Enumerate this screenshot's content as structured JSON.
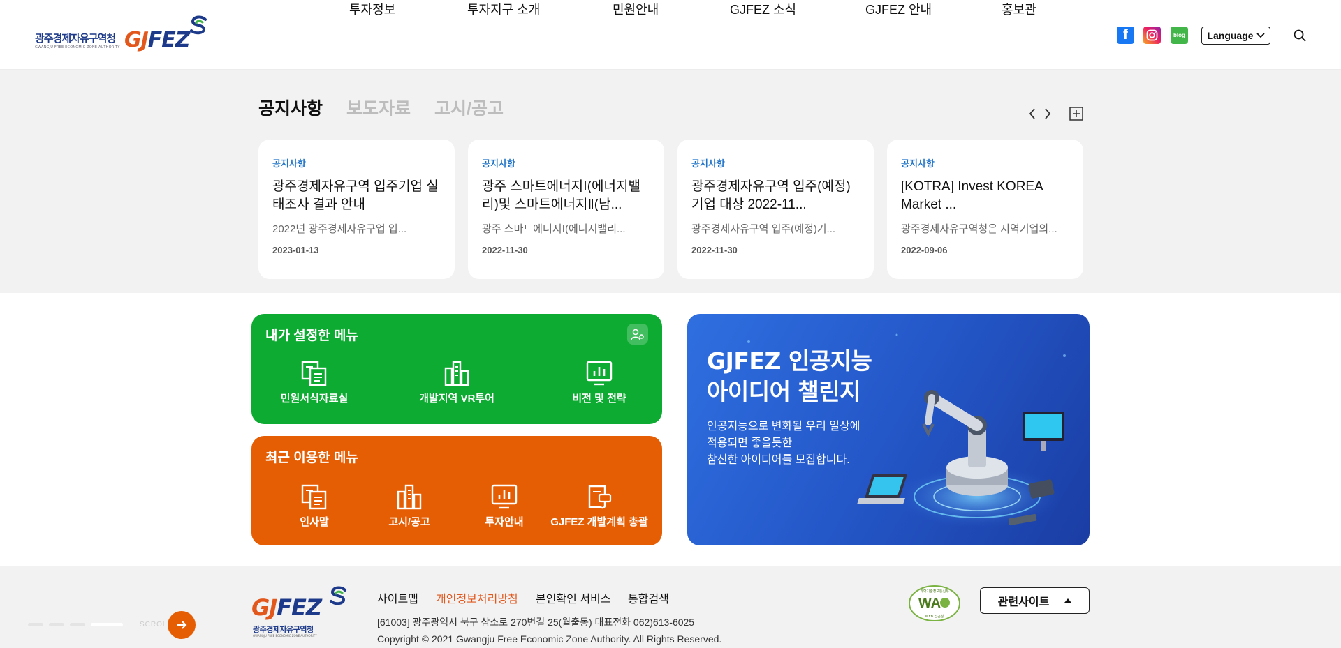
{
  "header": {
    "logo_korean": "광주경제자유구역청",
    "logo_sub": "GWANGJU FREE ECONOMIC ZONE AUTHORITY",
    "logo_mark_orange": "GJ",
    "logo_mark_blue": "FEZ",
    "nav": [
      "투자정보",
      "투자지구 소개",
      "민원안내",
      "GJFEZ 소식",
      "GJFEZ 안내",
      "홍보관"
    ],
    "social": {
      "facebook": "f",
      "instagram_icon": "instagram-icon",
      "blog": "blog"
    },
    "language_label": "Language"
  },
  "notices": {
    "tabs": [
      "공지사항",
      "보도자료",
      "고시/공고"
    ],
    "active_tab": 0,
    "cards": [
      {
        "category": "공지사항",
        "title": "광주경제자유구역 입주기업 실태조사 결과 안내",
        "summary": "2022년 광주경제자유구업 입...",
        "date": "2023-01-13"
      },
      {
        "category": "공지사항",
        "title": "광주 스마트에너지Ⅰ(에너지밸리)및 스마트에너지Ⅱ(남...",
        "summary": "광주 스마트에너지Ⅰ(에너지밸리...",
        "date": "2022-11-30"
      },
      {
        "category": "공지사항",
        "title": "광주경제자유구역 입주(예정)기업 대상 2022-11...",
        "summary": "광주경제자유구역 입주(예정)기...",
        "date": "2022-11-30"
      },
      {
        "category": "공지사항",
        "title": "[KOTRA] Invest KOREA Market ...",
        "summary": "광주경제자유구역청은 지역기업의...",
        "date": "2022-09-06"
      }
    ]
  },
  "my_menu": {
    "title": "내가 설정한 메뉴",
    "items": [
      "민원서식자료실",
      "개발지역 VR투어",
      "비전 및 전략"
    ]
  },
  "recent_menu": {
    "title": "최근 이용한 메뉴",
    "items": [
      "인사말",
      "고시/공고",
      "투자안내",
      "GJFEZ 개발계획 총괄"
    ]
  },
  "banner": {
    "headline_line1": "GJFEZ 인공지능",
    "headline_line2": "아이디어 챌린지",
    "desc_line1": "인공지능으로 변화될 우리 일상에",
    "desc_line2": "적용되면 좋을듯한",
    "desc_line3": "참신한 아이디어를 모집합니다."
  },
  "footer": {
    "logo_korean": "광주경제자유구역청",
    "logo_sub": "GWANGJU FREE ECONOMIC ZONE AUTHORITY",
    "links": [
      "사이트맵",
      "개인정보처리방침",
      "본인확인 서비스",
      "통합검색"
    ],
    "address": "[61003] 광주광역시 북구 삼소로 270번길 25(월출동) 대표전화 062)613-6025",
    "copyright": "Copyright © 2021 Gwangju Free Economic Zone Authority. All Rights Reserved.",
    "wa_badge_text": "WA",
    "wa_badge_top": "과학기술정보통신부",
    "wa_badge_bottom": "WEB 접근성",
    "related_sites": "관련사이트",
    "scroll_label": "SCROLL"
  },
  "colors": {
    "brand_orange": "#e65e04",
    "brand_green": "#0eab32",
    "brand_navy": "#1d3a8a",
    "accent_blue": "#1f74c9"
  }
}
